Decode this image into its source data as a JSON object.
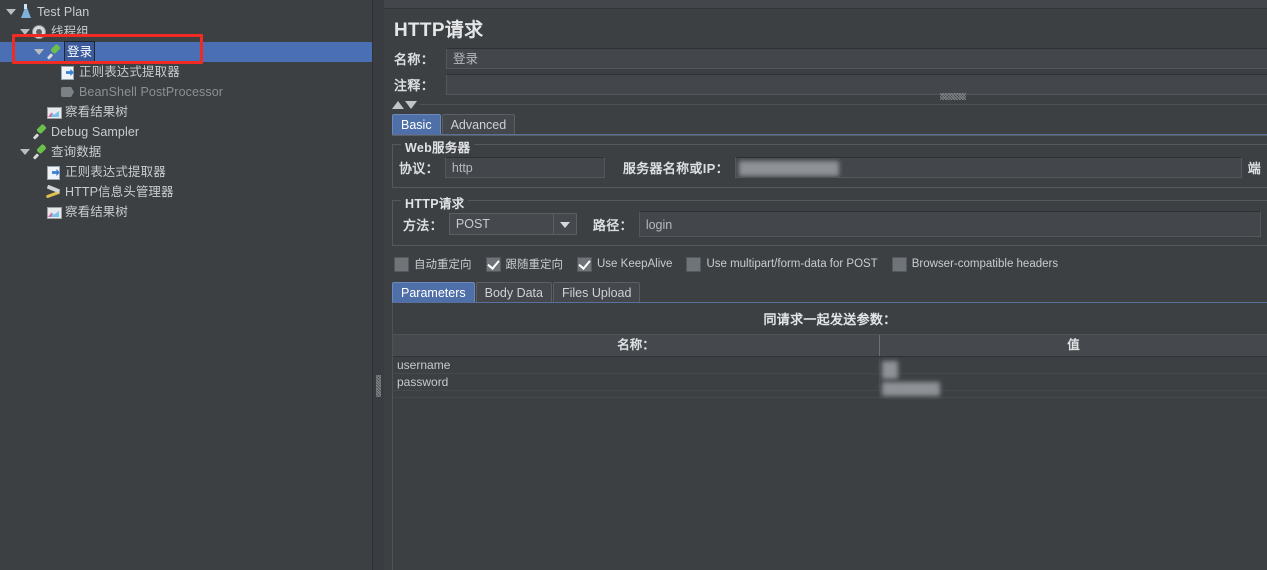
{
  "tree": {
    "items": [
      {
        "label": "Test Plan",
        "icon": "test-plan-icon",
        "indent": 0,
        "twisty": "open",
        "state": "normal"
      },
      {
        "label": "线程组",
        "icon": "thread-group-icon",
        "indent": 1,
        "twisty": "open",
        "state": "normal"
      },
      {
        "label": "登录",
        "icon": "http-sampler-icon",
        "indent": 2,
        "twisty": "open",
        "state": "selected"
      },
      {
        "label": "正则表达式提取器",
        "icon": "regex-extractor-icon",
        "indent": 3,
        "twisty": "none",
        "state": "normal"
      },
      {
        "label": "BeanShell PostProcessor",
        "icon": "beanshell-postprocessor-icon",
        "indent": 3,
        "twisty": "none",
        "state": "dim"
      },
      {
        "label": "察看结果树",
        "icon": "view-results-tree-icon",
        "indent": 2,
        "twisty": "none",
        "state": "normal"
      },
      {
        "label": "Debug Sampler",
        "icon": "debug-sampler-icon",
        "indent": 1,
        "twisty": "none",
        "state": "normal"
      },
      {
        "label": "查询数据",
        "icon": "http-sampler-icon",
        "indent": 1,
        "twisty": "open",
        "state": "normal"
      },
      {
        "label": "正则表达式提取器",
        "icon": "regex-extractor-icon",
        "indent": 2,
        "twisty": "none",
        "state": "normal"
      },
      {
        "label": "HTTP信息头管理器",
        "icon": "header-manager-icon",
        "indent": 2,
        "twisty": "none",
        "state": "normal"
      },
      {
        "label": "察看结果树",
        "icon": "view-results-tree-icon",
        "indent": 2,
        "twisty": "none",
        "state": "normal"
      }
    ],
    "highlight_color": "#ef2b24",
    "selection_color": "#4a6fb5"
  },
  "editor": {
    "title": "HTTP请求",
    "name_label": "名称：",
    "name_value": "登录",
    "comment_label": "注释：",
    "comment_value": "",
    "tabs": [
      {
        "label": "Basic",
        "active": true
      },
      {
        "label": "Advanced",
        "active": false
      }
    ],
    "web_server": {
      "legend": "Web服务器",
      "protocol_label": "协议：",
      "protocol_value": "http",
      "server_label": "服务器名称或IP：",
      "server_value": "",
      "port_label": "端"
    },
    "http_request": {
      "legend": "HTTP请求",
      "method_label": "方法：",
      "method_value": "POST",
      "path_label": "路径：",
      "path_value": "login"
    },
    "checkboxes": [
      {
        "label": "自动重定向",
        "checked": false
      },
      {
        "label": "跟随重定向",
        "checked": true
      },
      {
        "label": "Use KeepAlive",
        "checked": true
      },
      {
        "label": "Use multipart/form-data for POST",
        "checked": false
      },
      {
        "label": "Browser-compatible headers",
        "checked": false
      }
    ],
    "param_tabs": [
      {
        "label": "Parameters",
        "active": true
      },
      {
        "label": "Body Data",
        "active": false
      },
      {
        "label": "Files Upload",
        "active": false
      }
    ],
    "params": {
      "title": "同请求一起发送参数：",
      "columns": [
        "名称：",
        "值"
      ],
      "rows": [
        {
          "name": "username",
          "value": "",
          "redacted": true
        },
        {
          "name": "password",
          "value": "",
          "redacted": true
        }
      ]
    }
  }
}
